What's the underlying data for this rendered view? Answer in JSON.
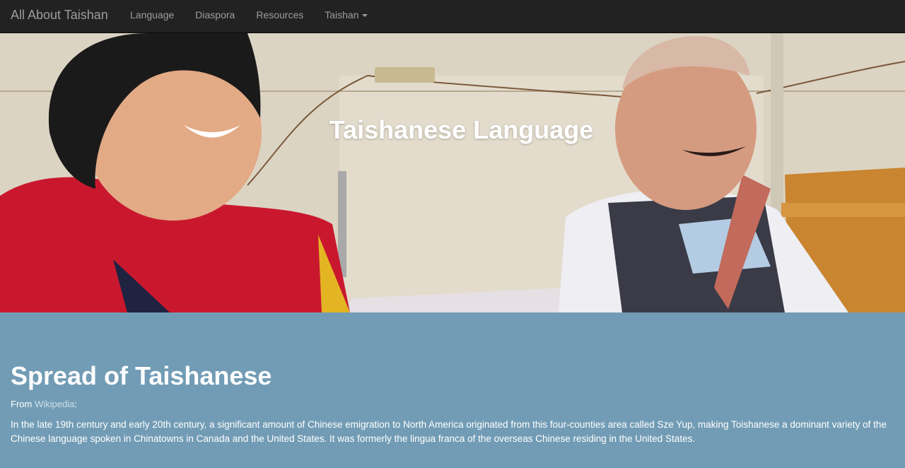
{
  "navbar": {
    "brand": "All About Taishan",
    "items": [
      {
        "label": "Language"
      },
      {
        "label": "Diaspora"
      },
      {
        "label": "Resources"
      },
      {
        "label": "Taishan"
      }
    ]
  },
  "hero": {
    "title": "Taishanese Language"
  },
  "section": {
    "heading": "Spread of Taishanese",
    "source_prefix": "From ",
    "source_link": "Wikipedia",
    "source_suffix": ":",
    "paragraph": "In the late 19th century and early 20th century, a significant amount of Chinese emigration to North America originated from this four-counties area called Sze Yup, making Toishanese a dominant variety of the Chinese language spoken in Chinatowns in Canada and the United States. It was formerly the lingua franca of the overseas Chinese residing in the United States."
  },
  "colors": {
    "navbar_bg": "#222222",
    "nav_text": "#9d9d9d",
    "section_bg": "#729cb5",
    "text": "#ffffff"
  }
}
